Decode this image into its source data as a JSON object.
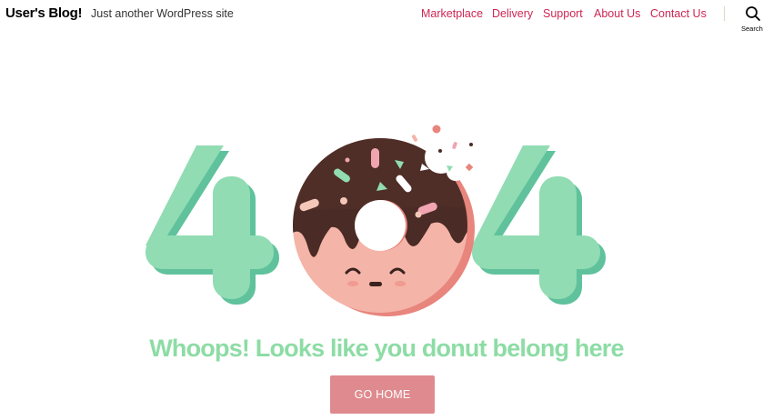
{
  "header": {
    "site_title": "User's Blog!",
    "tagline": "Just another WordPress site",
    "nav": [
      {
        "label": "Marketplace"
      },
      {
        "label": "Delivery"
      },
      {
        "label": "Support"
      },
      {
        "label": "About Us"
      },
      {
        "label": "Contact Us"
      }
    ],
    "search_label": "Search"
  },
  "error": {
    "code_image": "404 donut illustration",
    "headline": "Whoops! Looks like you donut belong here",
    "button_label": "GO HOME"
  },
  "colors": {
    "accent": "#cd2653",
    "mint": "#8ddca5",
    "button": "#df8a8e",
    "donut_icing": "#4a2b25",
    "donut_dough": "#f4b4a8"
  }
}
